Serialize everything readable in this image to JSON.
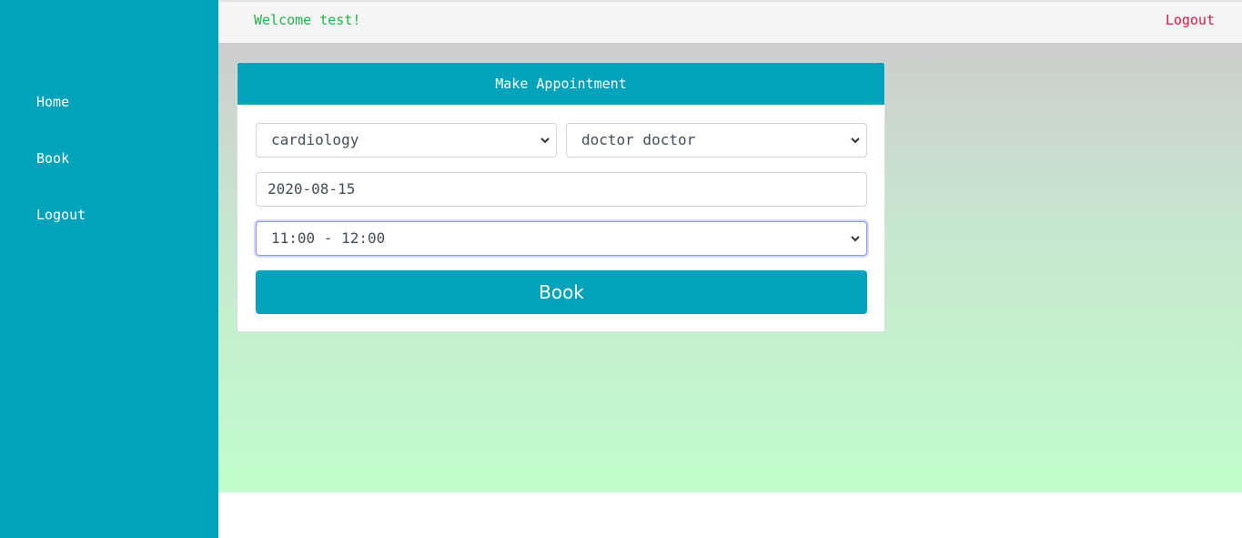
{
  "sidebar": {
    "items": [
      {
        "label": "Home"
      },
      {
        "label": "Book"
      },
      {
        "label": "Logout"
      }
    ]
  },
  "header": {
    "welcome": "Welcome test!",
    "logout_label": "Logout"
  },
  "form": {
    "title": "Make Appointment",
    "department_select": "cardiology",
    "doctor_select": "doctor doctor",
    "date_value": "2020-08-15",
    "time_select": "11:00 - 12:00",
    "submit_label": "Book"
  },
  "colors": {
    "accent": "#00a3b9",
    "welcome_text": "#21b44a",
    "logout_text": "#d6194a"
  }
}
